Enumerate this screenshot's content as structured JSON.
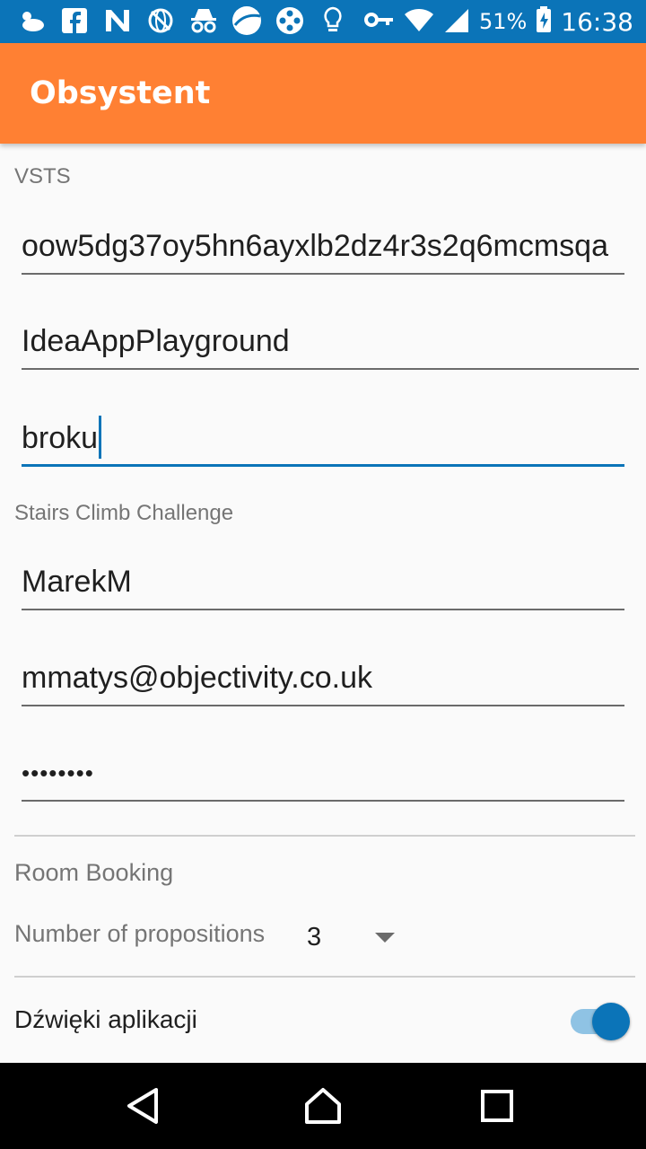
{
  "status_bar": {
    "battery": "51%",
    "time": "16:38",
    "icons_left": [
      "weather-icon",
      "facebook-icon",
      "n-app-icon",
      "globe-icon",
      "incognito-icon",
      "ball-icon",
      "film-reel-icon",
      "lightbulb-icon"
    ],
    "icons_right": [
      "key-icon",
      "wifi-icon",
      "signal-icon",
      "battery-icon"
    ]
  },
  "app_bar": {
    "title": "Obsystent",
    "color": "#ff8033"
  },
  "sections": {
    "vsts": {
      "title": "VSTS",
      "token_value": "oow5dg37oy5hn6ayxlb2dz4r3s2q6mcmsqa",
      "project_value": "IdeaAppPlayground",
      "user_value": "broku"
    },
    "stairs": {
      "title": "Stairs Climb Challenge",
      "name_value": "MarekM",
      "email_value": "mmatys@objectivity.co.uk",
      "password_value": "••••••••"
    },
    "room_booking": {
      "title": "Room Booking",
      "propositions_label": "Number of propositions",
      "propositions_value": "3"
    },
    "sounds": {
      "label": "Dźwięki aplikacji",
      "enabled": true
    }
  },
  "nav_bar": {
    "buttons": [
      "back-icon",
      "home-icon",
      "recents-icon"
    ]
  },
  "colors": {
    "accent": "#0b74b8",
    "primary": "#ff8033",
    "status_bar": "#0b74b8"
  }
}
